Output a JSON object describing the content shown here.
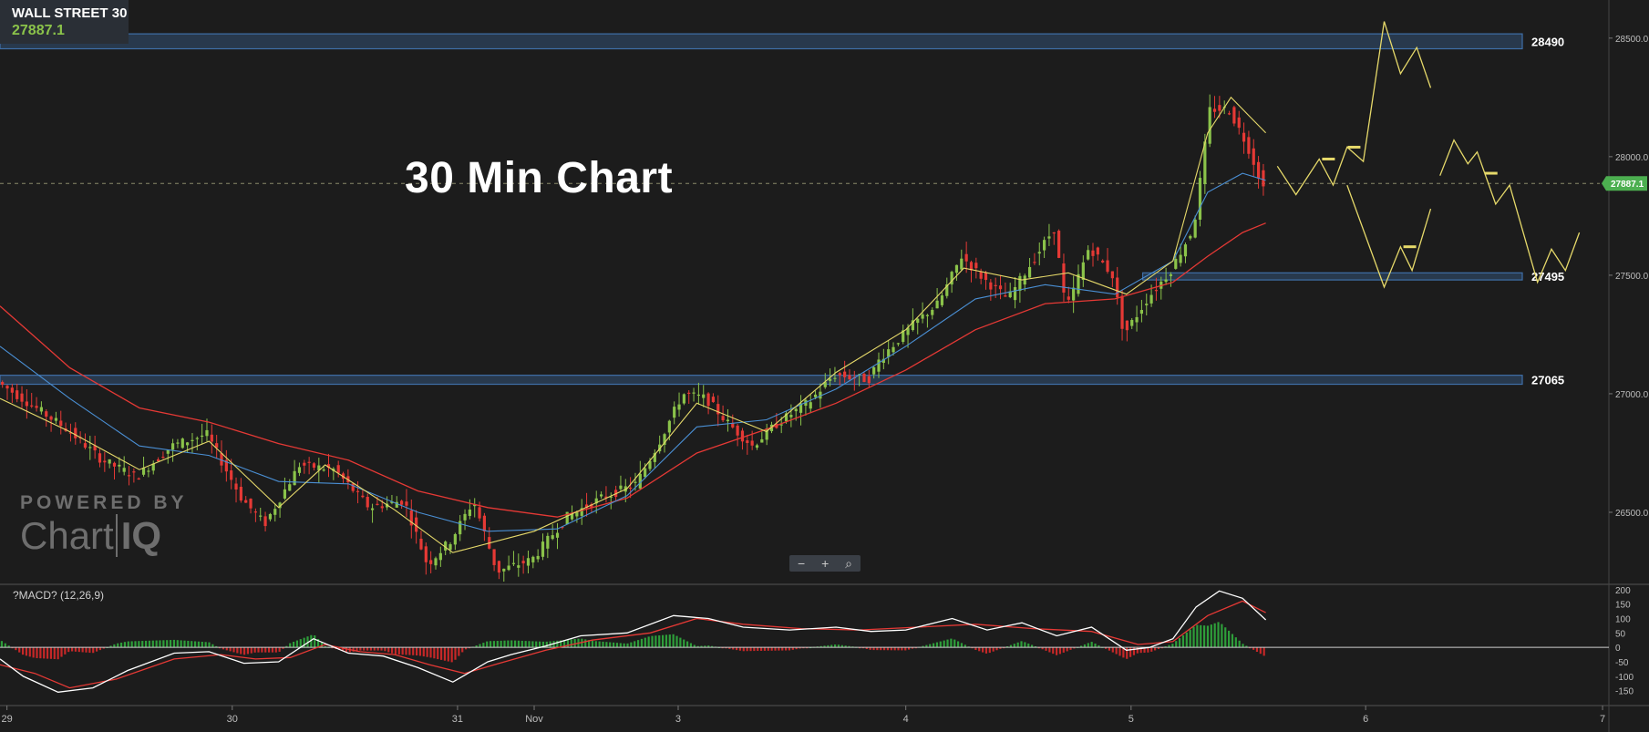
{
  "symbol": {
    "name": "WALL STREET 30",
    "price": "27887.1"
  },
  "title": "30 Min Chart",
  "watermark": {
    "powered_by": "POWERED BY",
    "brand_a": "Chart",
    "brand_b": "IQ"
  },
  "zoom": {
    "minus": "−",
    "plus": "+",
    "reset": "⌕"
  },
  "macd_label": "?MACD? (12,26,9)",
  "colors": {
    "background": "#1c1c1c",
    "up_candle": "#8bc34a",
    "down_candle": "#e53935",
    "ema_fast": "#e6d96a",
    "ema_mid": "#4a8fd4",
    "ema_slow": "#e53935",
    "zone": "#3f6fa8",
    "price_tag": "#4caf50"
  },
  "chart_data": {
    "type": "candlestick",
    "y_range": [
      26200,
      28630
    ],
    "y_ticks": [
      {
        "value": 28500,
        "label": "28500.0"
      },
      {
        "value": 28000,
        "label": "28000.0"
      },
      {
        "value": 27500,
        "label": "27500.0"
      },
      {
        "value": 27000,
        "label": "27000.0"
      },
      {
        "value": 26500,
        "label": "26500.0"
      }
    ],
    "x_ticks": [
      {
        "t": 0.03,
        "label": "29"
      },
      {
        "t": 1.0,
        "label": "30"
      },
      {
        "t": 1.97,
        "label": "31"
      },
      {
        "t": 2.3,
        "label": "Nov"
      },
      {
        "t": 2.92,
        "label": "3"
      },
      {
        "t": 3.9,
        "label": "4"
      },
      {
        "t": 4.87,
        "label": "5"
      },
      {
        "t": 5.88,
        "label": "6"
      },
      {
        "t": 6.9,
        "label": "7"
      }
    ],
    "x_range": [
      0,
      7.1
    ],
    "last_price": {
      "value": 27887.1,
      "label": "27887.1"
    },
    "zones": [
      {
        "label": "28490",
        "low": 28455,
        "high": 28518,
        "start": 0
      },
      {
        "label": "27495",
        "low": 27480,
        "high": 27510,
        "start": 4.92
      },
      {
        "label": "27065",
        "low": 27040,
        "high": 27078,
        "start": 0
      }
    ],
    "price_path": [
      [
        0.0,
        27050
      ],
      [
        0.15,
        26950
      ],
      [
        0.3,
        26850
      ],
      [
        0.45,
        26720
      ],
      [
        0.6,
        26650
      ],
      [
        0.75,
        26780
      ],
      [
        0.9,
        26830
      ],
      [
        1.05,
        26560
      ],
      [
        1.15,
        26450
      ],
      [
        1.3,
        26700
      ],
      [
        1.45,
        26680
      ],
      [
        1.6,
        26520
      ],
      [
        1.75,
        26550
      ],
      [
        1.85,
        26280
      ],
      [
        1.95,
        26380
      ],
      [
        2.05,
        26550
      ],
      [
        2.15,
        26250
      ],
      [
        2.3,
        26300
      ],
      [
        2.45,
        26480
      ],
      [
        2.6,
        26560
      ],
      [
        2.75,
        26620
      ],
      [
        2.85,
        26800
      ],
      [
        2.95,
        27000
      ],
      [
        3.05,
        26980
      ],
      [
        3.15,
        26870
      ],
      [
        3.25,
        26780
      ],
      [
        3.35,
        26870
      ],
      [
        3.5,
        26970
      ],
      [
        3.6,
        27080
      ],
      [
        3.75,
        27060
      ],
      [
        3.8,
        27150
      ],
      [
        3.95,
        27300
      ],
      [
        4.05,
        27380
      ],
      [
        4.15,
        27580
      ],
      [
        4.25,
        27480
      ],
      [
        4.35,
        27400
      ],
      [
        4.45,
        27550
      ],
      [
        4.55,
        27700
      ],
      [
        4.6,
        27350
      ],
      [
        4.7,
        27620
      ],
      [
        4.8,
        27500
      ],
      [
        4.85,
        27250
      ],
      [
        4.95,
        27400
      ],
      [
        5.05,
        27520
      ],
      [
        5.15,
        27700
      ],
      [
        5.22,
        28200
      ],
      [
        5.3,
        28200
      ],
      [
        5.38,
        28050
      ],
      [
        5.45,
        27870
      ]
    ],
    "ema_fast": [
      [
        0.0,
        26980
      ],
      [
        0.3,
        26840
      ],
      [
        0.6,
        26680
      ],
      [
        0.9,
        26800
      ],
      [
        1.2,
        26520
      ],
      [
        1.4,
        26700
      ],
      [
        1.7,
        26510
      ],
      [
        1.95,
        26330
      ],
      [
        2.3,
        26420
      ],
      [
        2.7,
        26600
      ],
      [
        3.0,
        26960
      ],
      [
        3.3,
        26840
      ],
      [
        3.6,
        27090
      ],
      [
        3.9,
        27270
      ],
      [
        4.15,
        27530
      ],
      [
        4.4,
        27480
      ],
      [
        4.6,
        27510
      ],
      [
        4.85,
        27420
      ],
      [
        5.05,
        27560
      ],
      [
        5.2,
        28100
      ],
      [
        5.3,
        28250
      ],
      [
        5.45,
        28100
      ]
    ],
    "ema_mid": [
      [
        0.0,
        27200
      ],
      [
        0.3,
        26980
      ],
      [
        0.6,
        26780
      ],
      [
        0.9,
        26740
      ],
      [
        1.2,
        26630
      ],
      [
        1.5,
        26620
      ],
      [
        1.8,
        26500
      ],
      [
        2.1,
        26420
      ],
      [
        2.4,
        26430
      ],
      [
        2.7,
        26570
      ],
      [
        3.0,
        26860
      ],
      [
        3.3,
        26890
      ],
      [
        3.6,
        27020
      ],
      [
        3.9,
        27200
      ],
      [
        4.2,
        27400
      ],
      [
        4.5,
        27460
      ],
      [
        4.8,
        27420
      ],
      [
        5.05,
        27560
      ],
      [
        5.2,
        27850
      ],
      [
        5.35,
        27930
      ],
      [
        5.45,
        27900
      ]
    ],
    "ema_slow": [
      [
        0.0,
        27370
      ],
      [
        0.3,
        27110
      ],
      [
        0.6,
        26940
      ],
      [
        0.9,
        26880
      ],
      [
        1.2,
        26790
      ],
      [
        1.5,
        26720
      ],
      [
        1.8,
        26590
      ],
      [
        2.1,
        26520
      ],
      [
        2.4,
        26480
      ],
      [
        2.7,
        26560
      ],
      [
        3.0,
        26750
      ],
      [
        3.3,
        26850
      ],
      [
        3.6,
        26960
      ],
      [
        3.9,
        27100
      ],
      [
        4.2,
        27270
      ],
      [
        4.5,
        27380
      ],
      [
        4.8,
        27400
      ],
      [
        5.05,
        27470
      ],
      [
        5.2,
        27580
      ],
      [
        5.35,
        27680
      ],
      [
        5.45,
        27720
      ]
    ],
    "scenarios": [
      {
        "points": [
          [
            5.5,
            27960
          ],
          [
            5.58,
            27840
          ],
          [
            5.68,
            27990
          ],
          [
            5.74,
            27880
          ],
          [
            5.8,
            28040
          ],
          [
            5.87,
            27980
          ],
          [
            5.96,
            28570
          ],
          [
            6.03,
            28350
          ],
          [
            6.1,
            28460
          ],
          [
            6.16,
            28290
          ]
        ],
        "markers": [
          [
            5.72,
            27990
          ],
          [
            5.83,
            28040
          ]
        ]
      },
      {
        "points": [
          [
            5.8,
            27880
          ],
          [
            5.96,
            27450
          ],
          [
            6.03,
            27620
          ],
          [
            6.08,
            27520
          ],
          [
            6.16,
            27780
          ]
        ],
        "markers": [
          [
            6.07,
            27620
          ]
        ]
      },
      {
        "points": [
          [
            6.2,
            27920
          ],
          [
            6.26,
            28070
          ],
          [
            6.32,
            27970
          ],
          [
            6.36,
            28020
          ],
          [
            6.44,
            27800
          ],
          [
            6.5,
            27880
          ],
          [
            6.62,
            27470
          ],
          [
            6.68,
            27610
          ],
          [
            6.74,
            27520
          ],
          [
            6.8,
            27680
          ]
        ],
        "markers": [
          [
            6.42,
            27930
          ]
        ]
      }
    ],
    "macd": {
      "label": "?MACD? (12,26,9)",
      "y_range": [
        -195,
        215
      ],
      "y_ticks": [
        {
          "value": 200,
          "label": "200"
        },
        {
          "value": 150,
          "label": "150"
        },
        {
          "value": 100,
          "label": "100"
        },
        {
          "value": 50,
          "label": "50"
        },
        {
          "value": 0,
          "label": "0"
        },
        {
          "value": -50,
          "label": "-50"
        },
        {
          "value": -100,
          "label": "-100"
        },
        {
          "value": -150,
          "label": "-150"
        }
      ],
      "macd_line": [
        [
          0.0,
          -40
        ],
        [
          0.1,
          -100
        ],
        [
          0.25,
          -155
        ],
        [
          0.4,
          -140
        ],
        [
          0.55,
          -80
        ],
        [
          0.75,
          -20
        ],
        [
          0.9,
          -15
        ],
        [
          1.05,
          -55
        ],
        [
          1.2,
          -50
        ],
        [
          1.35,
          30
        ],
        [
          1.5,
          -20
        ],
        [
          1.65,
          -30
        ],
        [
          1.8,
          -70
        ],
        [
          1.95,
          -120
        ],
        [
          2.1,
          -50
        ],
        [
          2.2,
          -25
        ],
        [
          2.35,
          5
        ],
        [
          2.5,
          40
        ],
        [
          2.7,
          50
        ],
        [
          2.9,
          110
        ],
        [
          3.05,
          100
        ],
        [
          3.2,
          70
        ],
        [
          3.4,
          60
        ],
        [
          3.6,
          70
        ],
        [
          3.75,
          55
        ],
        [
          3.9,
          60
        ],
        [
          4.1,
          100
        ],
        [
          4.25,
          60
        ],
        [
          4.4,
          85
        ],
        [
          4.55,
          40
        ],
        [
          4.7,
          70
        ],
        [
          4.85,
          -10
        ],
        [
          4.95,
          0
        ],
        [
          5.05,
          30
        ],
        [
          5.15,
          140
        ],
        [
          5.25,
          195
        ],
        [
          5.35,
          170
        ],
        [
          5.45,
          95
        ]
      ],
      "signal_line": [
        [
          0.0,
          -60
        ],
        [
          0.15,
          -90
        ],
        [
          0.3,
          -140
        ],
        [
          0.5,
          -110
        ],
        [
          0.75,
          -40
        ],
        [
          0.95,
          -25
        ],
        [
          1.1,
          -40
        ],
        [
          1.25,
          -35
        ],
        [
          1.4,
          10
        ],
        [
          1.55,
          -15
        ],
        [
          1.7,
          -25
        ],
        [
          1.85,
          -60
        ],
        [
          2.0,
          -90
        ],
        [
          2.15,
          -55
        ],
        [
          2.35,
          -10
        ],
        [
          2.55,
          25
        ],
        [
          2.8,
          50
        ],
        [
          3.0,
          100
        ],
        [
          3.2,
          80
        ],
        [
          3.45,
          65
        ],
        [
          3.7,
          60
        ],
        [
          3.95,
          70
        ],
        [
          4.2,
          80
        ],
        [
          4.45,
          65
        ],
        [
          4.7,
          55
        ],
        [
          4.9,
          10
        ],
        [
          5.05,
          20
        ],
        [
          5.2,
          110
        ],
        [
          5.35,
          160
        ],
        [
          5.45,
          120
        ]
      ]
    }
  }
}
